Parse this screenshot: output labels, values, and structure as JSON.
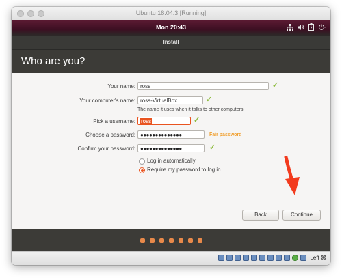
{
  "window": {
    "title": "Ubuntu 18.04.3 [Running]"
  },
  "panel": {
    "clock": "Mon 20:43",
    "icons": [
      "network-icon",
      "volume-icon",
      "battery-icon",
      "power-icon"
    ]
  },
  "dialog": {
    "title": "Install",
    "heading": "Who are you?",
    "fields": {
      "name_label": "Your name:",
      "name_value": "ross",
      "computer_label": "Your computer's name:",
      "computer_value": "ross-VirtualBox",
      "computer_hint": "The name it uses when it talks to other computers.",
      "username_label": "Pick a username:",
      "username_value": "ross",
      "password_label": "Choose a password:",
      "password_value": "●●●●●●●●●●●●●●",
      "password_strength": "Fair password",
      "confirm_label": "Confirm your password:",
      "confirm_value": "●●●●●●●●●●●●●●"
    },
    "login_options": {
      "auto": "Log in automatically",
      "require": "Require my password to log in",
      "selected": "require"
    },
    "buttons": {
      "back": "Back",
      "continue": "Continue"
    },
    "progress": {
      "total_steps": 7
    }
  },
  "statusbar": {
    "host_key": "Left ⌘"
  },
  "colors": {
    "accent": "#e95420",
    "check": "#8dbb3d",
    "fair_password": "#f0a030",
    "annotation_arrow": "#f23b1e"
  }
}
